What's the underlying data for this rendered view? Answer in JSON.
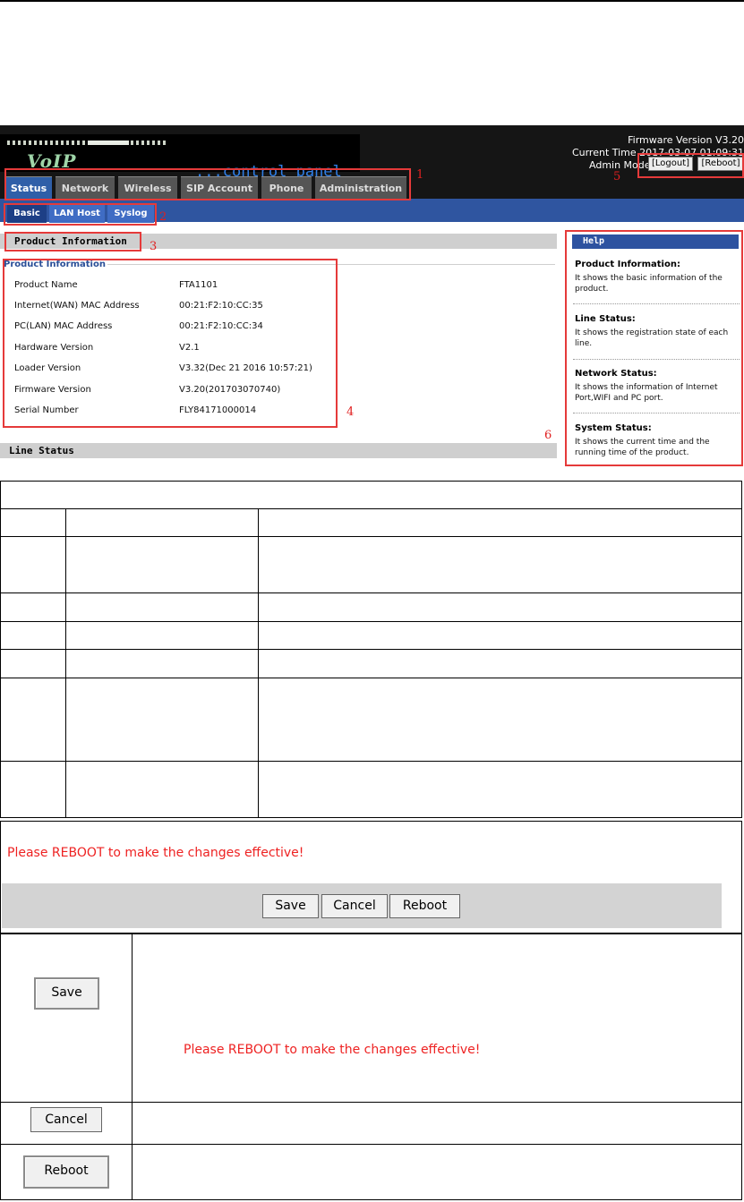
{
  "header": {
    "logo_voip": "VoIP",
    "logo_control_panel": "control panel",
    "firmware_line": "Firmware Version V3.20",
    "current_time_line": "Current Time 2017-03-07 01:09:31",
    "admin_mode": "Admin Mode",
    "logout_label": "[Logout]",
    "reboot_label": "[Reboot]"
  },
  "nav": {
    "tabs": [
      "Status",
      "Network",
      "Wireless",
      "SIP Account",
      "Phone",
      "Administration"
    ],
    "active": "Status"
  },
  "subnav": {
    "tabs": [
      "Basic",
      "LAN Host",
      "Syslog"
    ],
    "active": "Basic"
  },
  "sections": {
    "product_information": "Product Information",
    "line_status": "Line Status"
  },
  "product_info": {
    "legend": "Product Information",
    "rows": [
      {
        "label": "Product Name",
        "value": "FTA1101"
      },
      {
        "label": "Internet(WAN) MAC Address",
        "value": "00:21:F2:10:CC:35"
      },
      {
        "label": "PC(LAN) MAC Address",
        "value": "00:21:F2:10:CC:34"
      },
      {
        "label": "Hardware Version",
        "value": "V2.1"
      },
      {
        "label": "Loader Version",
        "value": "V3.32(Dec 21 2016 10:57:21)"
      },
      {
        "label": "Firmware Version",
        "value": "V3.20(201703070740)"
      },
      {
        "label": "Serial Number",
        "value": "FLY84171000014"
      }
    ]
  },
  "help": {
    "title": "Help",
    "items": [
      {
        "heading": "Product Information:",
        "text": "It shows the basic information of the product."
      },
      {
        "heading": "Line Status:",
        "text": "It shows the registration state of each line."
      },
      {
        "heading": "Network Status:",
        "text": "It shows the information of Internet Port,WIFI and PC port."
      },
      {
        "heading": "System Status:",
        "text": "It shows the current time and the running time of the product."
      }
    ]
  },
  "annotations": [
    "1",
    "2",
    "3",
    "4",
    "5",
    "6"
  ],
  "reboot_message": "Please REBOOT to make the changes effective!",
  "buttons": {
    "save": "Save",
    "cancel": "Cancel",
    "reboot": "Reboot"
  }
}
